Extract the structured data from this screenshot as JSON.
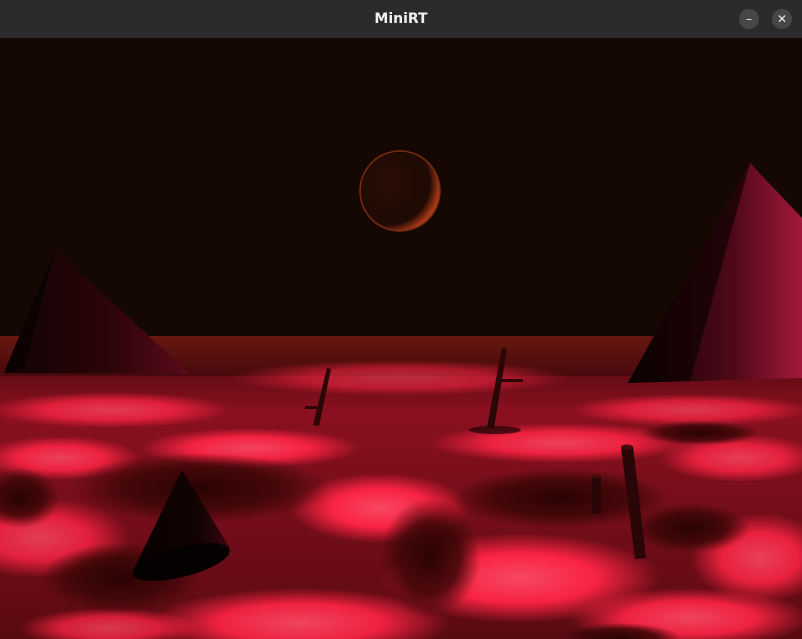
{
  "window": {
    "title": "MiniRT",
    "minimize_icon": "minimize-icon",
    "close_icon": "close-icon",
    "minimize_glyph": "–",
    "close_glyph": "✕"
  },
  "scene": {
    "sky_color": "#150803",
    "lava_bright": "#ff2b4a",
    "lava_dark": "#3a0606",
    "sphere_rim": "#d8421e",
    "shadow_color": "#050101"
  }
}
